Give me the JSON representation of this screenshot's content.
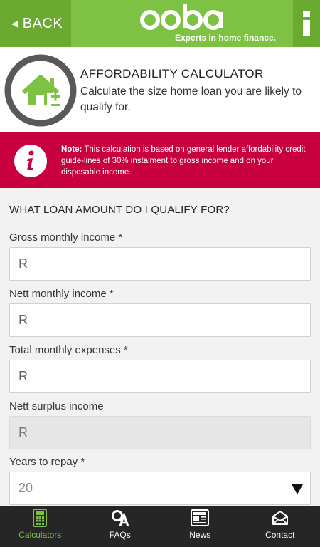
{
  "header": {
    "back_label": "BACK",
    "logo_text": "ooba",
    "tagline": "Experts in home finance.",
    "info_icon": "info-icon"
  },
  "intro": {
    "title": "AFFORDABILITY CALCULATOR",
    "description": "Calculate the size home loan you are likely to qualify for.",
    "icon": "house-plus-minus-icon"
  },
  "note": {
    "label": "Note:",
    "text": " This calculation is based on general lender affordability credit guide-lines of 30% instalment to gross income and on your disposable income.",
    "icon": "info-icon"
  },
  "form": {
    "section_title": "WHAT LOAN AMOUNT DO I QUALIFY FOR?",
    "fields": [
      {
        "label": "Gross monthly income *",
        "value": "R"
      },
      {
        "label": "Nett monthly income *",
        "value": "R"
      },
      {
        "label": "Total monthly expenses *",
        "value": "R"
      },
      {
        "label": "Nett surplus income",
        "value": "R"
      }
    ],
    "years": {
      "label": "Years to repay *",
      "value": "20"
    }
  },
  "nav": {
    "items": [
      {
        "label": "Calculators",
        "icon": "calculator-icon",
        "active": true
      },
      {
        "label": "FAQs",
        "icon": "qa-icon",
        "active": false
      },
      {
        "label": "News",
        "icon": "newspaper-icon",
        "active": false
      },
      {
        "label": "Contact",
        "icon": "envelope-icon",
        "active": false
      }
    ]
  },
  "colors": {
    "brand_green": "#7dc242",
    "note_red": "#c8003f",
    "nav_dark": "#262626"
  }
}
